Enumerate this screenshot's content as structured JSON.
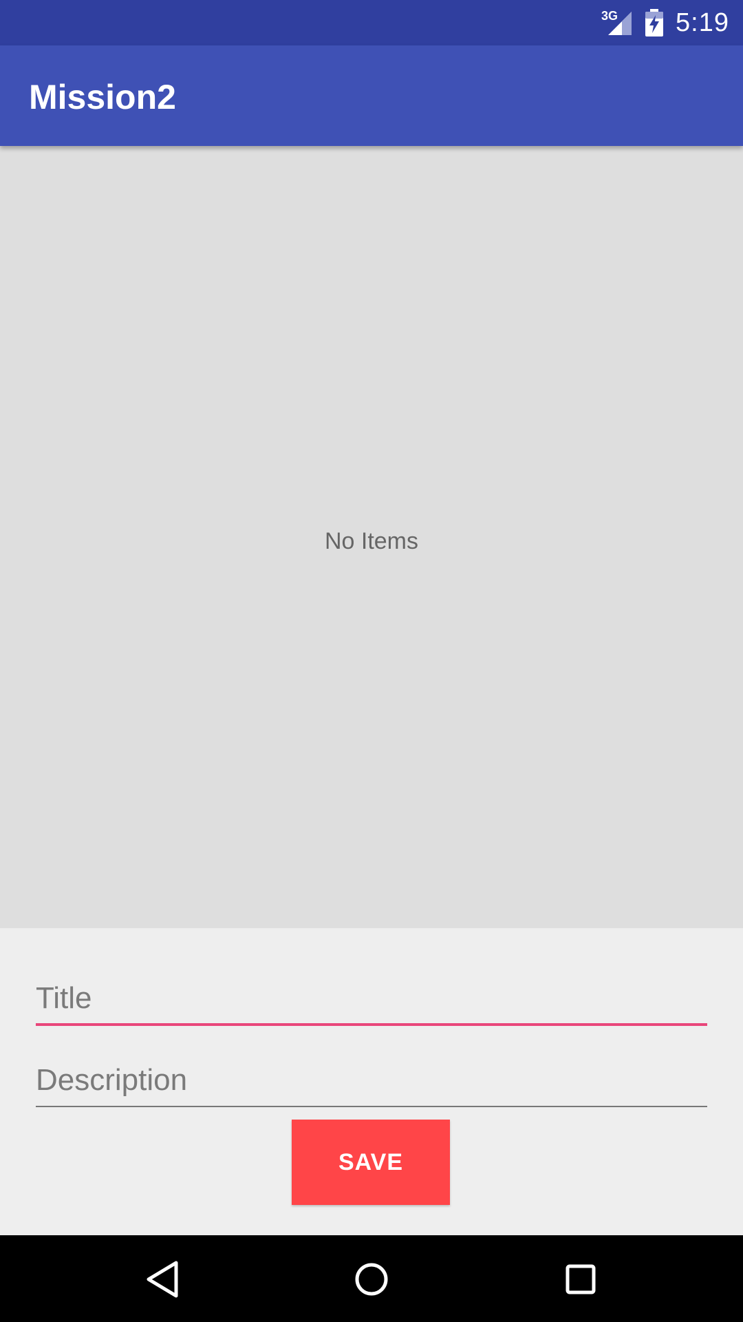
{
  "status_bar": {
    "network_type": "3G",
    "time": "5:19",
    "icons": [
      "signal-icon",
      "battery-charging-icon"
    ]
  },
  "app_bar": {
    "title": "Mission2"
  },
  "list": {
    "empty_text": "No Items"
  },
  "form": {
    "title_placeholder": "Title",
    "description_placeholder": "Description",
    "save_label": "SAVE"
  },
  "nav_bar": {
    "icons": [
      "back-icon",
      "home-icon",
      "recents-icon"
    ]
  },
  "colors": {
    "status_bar": "#303f9f",
    "app_bar": "#3f51b5",
    "accent_underline": "#e8467a",
    "save_button": "#ff4548",
    "list_background": "#dedede"
  }
}
